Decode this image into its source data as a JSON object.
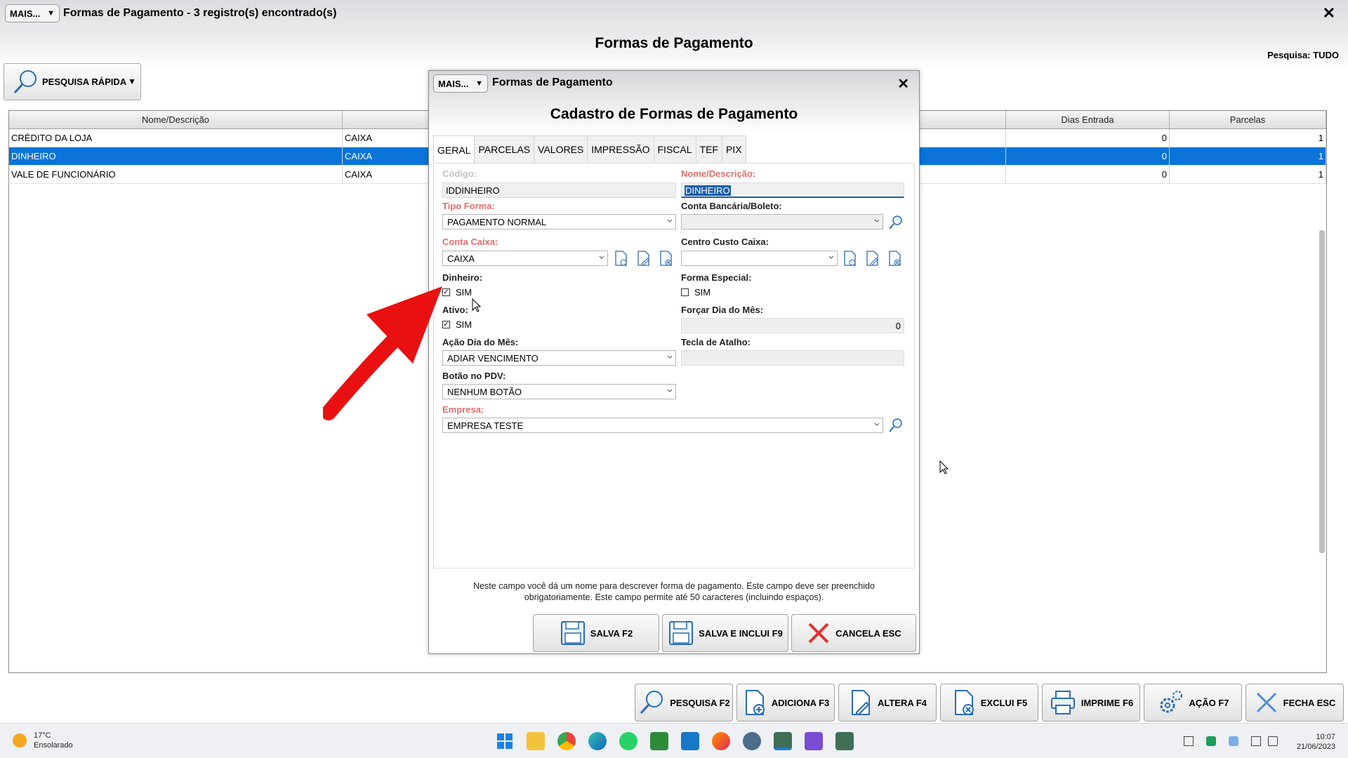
{
  "window": {
    "mais_label": "MAIS...",
    "title": "Formas de Pagamento - 3 registro(s) encontrado(s)",
    "close": "✕"
  },
  "header": {
    "page_title": "Formas de Pagamento",
    "pesquisa_label": "Pesquisa:",
    "pesquisa_value": "TUDO",
    "quick_search": "PESQUISA RÁPIDA"
  },
  "grid": {
    "columns": [
      "Nome/Descrição",
      "",
      "Dias Entrada",
      "Parcelas"
    ],
    "rows": [
      {
        "nome": "CRÉDITO DA LOJA",
        "conta": "CAIXA",
        "dias": "0",
        "parcelas": "1",
        "selected": false
      },
      {
        "nome": "DINHEIRO",
        "conta": "CAIXA",
        "dias": "0",
        "parcelas": "1",
        "selected": true
      },
      {
        "nome": "VALE DE FUNCIONÁRIO",
        "conta": "CAIXA",
        "dias": "0",
        "parcelas": "1",
        "selected": false
      }
    ]
  },
  "bottom_buttons": [
    {
      "label": "PESQUISA F2"
    },
    {
      "label": "ADICIONA F3"
    },
    {
      "label": "ALTERA F4"
    },
    {
      "label": "EXCLUI F5"
    },
    {
      "label": "IMPRIME F6"
    },
    {
      "label": "AÇÃO F7"
    },
    {
      "label": "FECHA ESC"
    }
  ],
  "modal": {
    "mais_label": "MAIS...",
    "title": "Formas de Pagamento",
    "close": "✕",
    "heading": "Cadastro de Formas de Pagamento",
    "tabs": [
      "GERAL",
      "PARCELAS",
      "VALORES",
      "IMPRESSÃO",
      "FISCAL",
      "TEF",
      "PIX"
    ],
    "fields": {
      "codigo_label": "Código:",
      "codigo_value": "IDDINHEIRO",
      "nome_label": "Nome/Descrição:",
      "nome_value": "DINHEIRO",
      "tipo_label": "Tipo Forma:",
      "tipo_value": "PAGAMENTO NORMAL",
      "conta_bancaria_label": "Conta Bancária/Boleto:",
      "conta_bancaria_value": "",
      "conta_caixa_label": "Conta Caixa:",
      "conta_caixa_value": "CAIXA",
      "centro_custo_label": "Centro Custo Caixa:",
      "centro_custo_value": "",
      "dinheiro_label": "Dinheiro:",
      "dinheiro_check": "SIM",
      "forma_especial_label": "Forma Especial:",
      "forma_especial_check": "SIM",
      "ativo_label": "Ativo:",
      "ativo_check": "SIM",
      "forcar_dia_label": "Forçar Dia do Mês:",
      "forcar_dia_value": "0",
      "acao_dia_label": "Ação Dia do Mês:",
      "acao_dia_value": "ADIAR VENCIMENTO",
      "tecla_label": "Tecla de Atalho:",
      "tecla_value": "",
      "botao_pdv_label": "Botão no PDV:",
      "botao_pdv_value": "NENHUM BOTÃO",
      "empresa_label": "Empresa:",
      "empresa_value": "EMPRESA TESTE"
    },
    "hint": "Neste campo você dá um nome para descrever forma de pagamento. Este campo deve ser preenchido obrigatoriamente. Este campo permite até 50 caracteres (incluindo espaços).",
    "buttons": {
      "salva": "SALVA F2",
      "salva_inclui": "SALVA E INCLUI F9",
      "cancela": "CANCELA ESC"
    }
  },
  "taskbar": {
    "temperature": "17°C",
    "weather": "Ensolarado",
    "time": "10:07",
    "date": "21/06/2023"
  },
  "colors": {
    "selected_row": "#0a74d8",
    "required_label": "#e06c6c",
    "annotation_arrow": "#e81010"
  }
}
